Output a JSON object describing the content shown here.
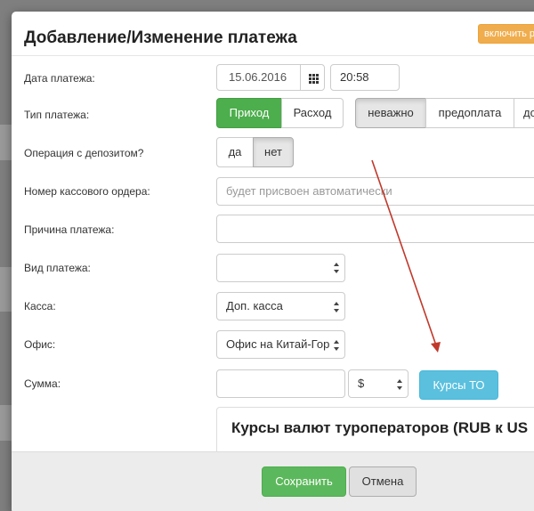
{
  "modal": {
    "title": "Добавление/Изменение платежа",
    "enable_button": "включить р"
  },
  "form": {
    "payment_date": {
      "label": "Дата платежа:",
      "date": "15.06.2016",
      "time": "20:58"
    },
    "payment_type": {
      "label": "Тип платежа:",
      "options": [
        "Приход",
        "Расход"
      ],
      "selected": "Приход"
    },
    "prepayment_type": {
      "options": [
        "неважно",
        "предоплата",
        "до"
      ],
      "selected": "неважно"
    },
    "deposit_operation": {
      "label": "Операция с депозитом?",
      "options": [
        "да",
        "нет"
      ],
      "selected": "нет"
    },
    "cash_order_number": {
      "label": "Номер кассового ордера:",
      "placeholder": "будет присвоен автоматически"
    },
    "payment_reason": {
      "label": "Причина платежа:",
      "value": ""
    },
    "payment_kind": {
      "label": "Вид платежа:",
      "value": ""
    },
    "cash_desk": {
      "label": "Касса:",
      "value": "Доп. касса"
    },
    "office": {
      "label": "Офис:",
      "value": "Офис на Китай-Гор"
    },
    "amount": {
      "label": "Сумма:",
      "value": "",
      "currency": "$",
      "rates_button": "Курсы ТО"
    }
  },
  "rates_panel": {
    "title": "Курсы валют туроператоров (RUB к US"
  },
  "footer": {
    "save": "Сохранить",
    "cancel": "Отмена"
  },
  "colors": {
    "success": "#5cb85c",
    "info": "#5bc0de",
    "warning": "#f0ad4e",
    "annotation_arrow": "#c0392b"
  }
}
